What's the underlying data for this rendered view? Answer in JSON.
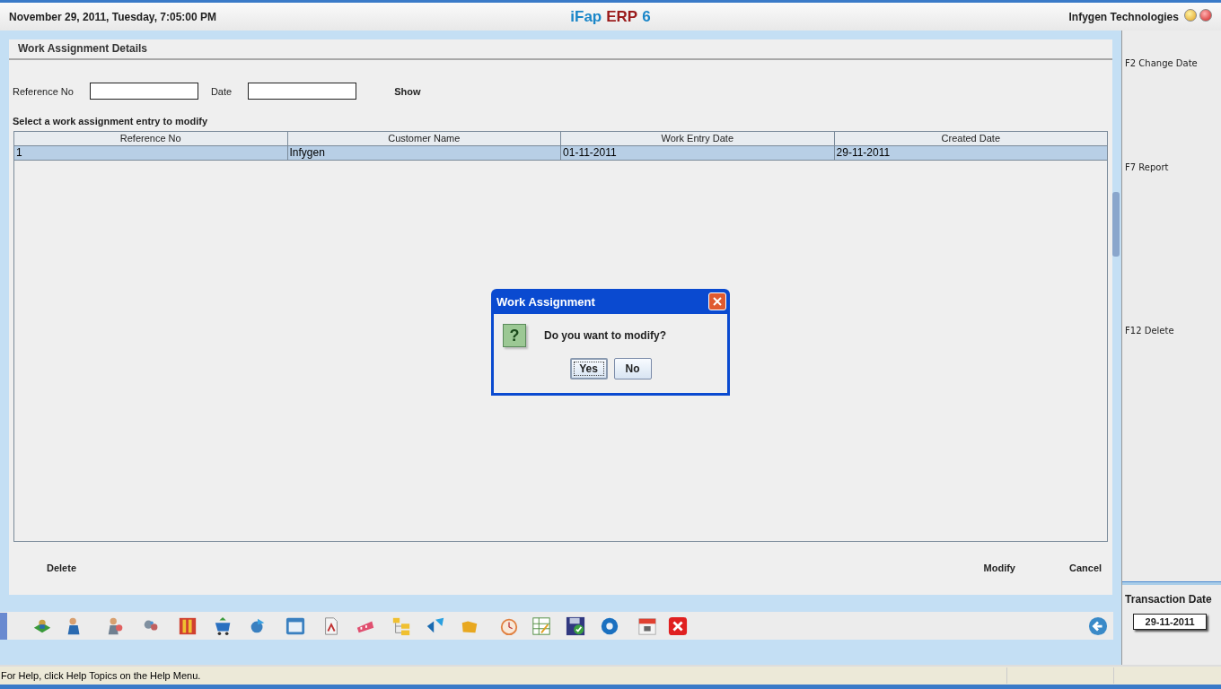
{
  "header": {
    "datetime": "November  29, 2011, Tuesday, 7:05:00 PM",
    "brand": {
      "name": "iFap",
      "product": "ERP",
      "version": "6"
    },
    "company": "Infygen Technologies"
  },
  "panel": {
    "title": "Work Assignment Details",
    "filters": [
      {
        "label": "Reference No"
      },
      {
        "label": "Date"
      }
    ],
    "show_button": "Show",
    "instruction": "Select a work assignment entry to modify",
    "table": {
      "columns": [
        "Reference No",
        "Customer Name",
        "Work Entry Date",
        "Created Date"
      ],
      "rows": [
        {
          "cells": [
            "1",
            "Infygen",
            "01-11-2011",
            "29-11-2011"
          ],
          "selected": true
        }
      ]
    },
    "left_buttons": [
      "Delete"
    ],
    "right_buttons": [
      "Modify",
      "Cancel"
    ]
  },
  "sidebar": {
    "shortcuts": [
      {
        "label": "F2 Change Date"
      },
      {
        "label": "F7 Report"
      },
      {
        "label": "F12 Delete"
      }
    ],
    "transaction_label": "Transaction Date",
    "transaction_date": "29-11-2011"
  },
  "dialog": {
    "title": "Work Assignment",
    "icon": "?",
    "message": "Do you want to modify?",
    "buttons": [
      {
        "label": "Yes",
        "focused": true
      },
      {
        "label": "No",
        "focused": false
      }
    ]
  },
  "status_bar": {
    "text": "For Help, click Help Topics on the Help Menu."
  }
}
